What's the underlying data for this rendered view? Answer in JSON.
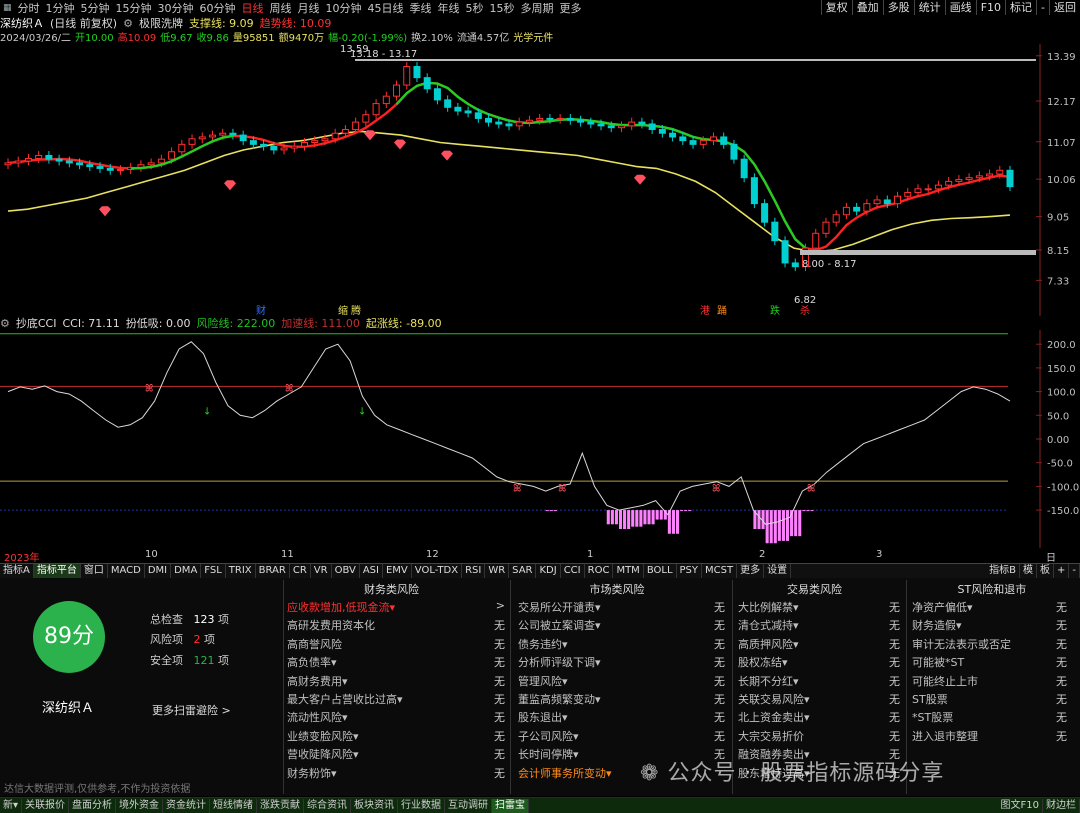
{
  "period_bar": [
    "分时",
    "1分钟",
    "5分钟",
    "15分钟",
    "30分钟",
    "60分钟",
    "日线",
    "周线",
    "月线",
    "10分钟",
    "45日线",
    "季线",
    "年线",
    "5秒",
    "15秒",
    "多周期",
    "更多"
  ],
  "period_active": "日线",
  "right_buttons": [
    "复权",
    "叠加",
    "多股",
    "统计",
    "画线",
    "F10",
    "标记",
    "-",
    "返回"
  ],
  "main_info": {
    "stock": "深纺织Ａ",
    "adj": "(日线 前复权)",
    "indicator": "极限洗牌",
    "support": "支撑线: 9.09",
    "trend": "趋势线: 10.09"
  },
  "quote": {
    "date": "2024/03/26/二",
    "open": "开10.00",
    "high": "高10.09",
    "low": "低9.67",
    "close": "收9.86",
    "volume": "量95851",
    "amount": "额9470万",
    "change": "幅-0.20(-1.99%)",
    "turnover": "换2.10%",
    "float": "流通4.57亿",
    "concept": "光学元件"
  },
  "price_axis": [
    "13.39",
    "12.17",
    "11.07",
    "10.06",
    "9.05",
    "8.15",
    "7.33"
  ],
  "annotations": {
    "high_label": "13.59",
    "high_range": "13.18 - 13.17",
    "low_range": "8.00 - 8.17",
    "low_label": "6.82"
  },
  "event_tags": [
    "财",
    "缩",
    "腾",
    "港",
    "踊",
    "跌",
    "杀"
  ],
  "cci_info": {
    "name": "抄底CCI",
    "cci": "CCI: 71.11",
    "low": "扮低吸: 0.00",
    "risk": "风险线: 222.00",
    "accel": "加速线: 111.00",
    "rise": "起涨线: -89.00"
  },
  "cci_axis": [
    "200.0",
    "150.0",
    "100.0",
    "50.0",
    "0.00",
    "-50.0",
    "-100.0",
    "-150.0"
  ],
  "date_axis": [
    "2023年",
    "10",
    "11",
    "12",
    "1",
    "2",
    "3",
    "日线"
  ],
  "tabs": [
    "指标A",
    "指标平台",
    "窗口",
    "MACD",
    "DMI",
    "DMA",
    "FSL",
    "TRIX",
    "BRAR",
    "CR",
    "VR",
    "OBV",
    "ASI",
    "EMV",
    "VOL-TDX",
    "RSI",
    "WR",
    "SAR",
    "KDJ",
    "CCI",
    "ROC",
    "MTM",
    "BOLL",
    "PSY",
    "MCST",
    "更多",
    "设置"
  ],
  "tabs_right": [
    "指标B",
    "模",
    "板",
    "+",
    "-"
  ],
  "score": {
    "value": "89分",
    "name": "深纺织Ａ",
    "total_label": "总检查",
    "total": "123",
    "unit": "项",
    "risk_label": "风险项",
    "risk": "2",
    "safe_label": "安全项",
    "safe": "121",
    "more": "更多扫雷避险 >",
    "disclaimer": "以上信息仅供参考,不作为投资依据",
    "disclaimer_display": "达信大数据评测,仅供参考,不作为投资依据"
  },
  "risk_columns": [
    {
      "title": "财务类风险",
      "items": [
        {
          "label": "应收款增加,低现金流▾",
          "value": ">",
          "hl": "red"
        },
        {
          "label": "高研发费用资本化",
          "value": "无"
        },
        {
          "label": "高商誉风险",
          "value": "无"
        },
        {
          "label": "高负债率▾",
          "value": "无"
        },
        {
          "label": "高财务费用▾",
          "value": "无"
        },
        {
          "label": "最大客户占营收比过高▾",
          "value": "无"
        },
        {
          "label": "流动性风险▾",
          "value": "无"
        },
        {
          "label": "业绩变脸风险▾",
          "value": "无"
        },
        {
          "label": "营收陡降风险▾",
          "value": "无"
        },
        {
          "label": "财务粉饰▾",
          "value": "无"
        }
      ]
    },
    {
      "title": "市场类风险",
      "items": [
        {
          "label": "交易所公开谴责▾",
          "value": "无"
        },
        {
          "label": "公司被立案调查▾",
          "value": "无"
        },
        {
          "label": "债务违约▾",
          "value": "无"
        },
        {
          "label": "分析师评级下调▾",
          "value": "无"
        },
        {
          "label": "管理风险▾",
          "value": "无"
        },
        {
          "label": "董监高频繁变动▾",
          "value": "无"
        },
        {
          "label": "股东退出▾",
          "value": "无"
        },
        {
          "label": "子公司风险▾",
          "value": "无"
        },
        {
          "label": "长时间停牌▾",
          "value": "无"
        },
        {
          "label": "会计师事务所变动▾",
          "value": "",
          "hl": "orange"
        }
      ]
    },
    {
      "title": "交易类风险",
      "items": [
        {
          "label": "大比例解禁▾",
          "value": "无"
        },
        {
          "label": "清仓式减持▾",
          "value": "无"
        },
        {
          "label": "高质押风险▾",
          "value": "无"
        },
        {
          "label": "股权冻结▾",
          "value": "无"
        },
        {
          "label": "长期不分红▾",
          "value": "无"
        },
        {
          "label": "关联交易风险▾",
          "value": "无"
        },
        {
          "label": "北上资金卖出▾",
          "value": "无"
        },
        {
          "label": "大宗交易折价",
          "value": "无"
        },
        {
          "label": "融资融券卖出▾",
          "value": "无"
        },
        {
          "label": "股东增持过高▾",
          "value": "无"
        }
      ]
    },
    {
      "title": "ST风险和退市",
      "items": [
        {
          "label": "净资产偏低▾",
          "value": "无"
        },
        {
          "label": "财务造假▾",
          "value": "无"
        },
        {
          "label": "审计无法表示或否定",
          "value": "无"
        },
        {
          "label": "可能被*ST",
          "value": "无"
        },
        {
          "label": "可能终止上市",
          "value": "无"
        },
        {
          "label": "ST股票",
          "value": "无"
        },
        {
          "label": "*ST股票",
          "value": "无"
        },
        {
          "label": "进入退市整理",
          "value": "无"
        }
      ]
    }
  ],
  "bottom_bar": [
    "新▾",
    "关联报价",
    "盘面分析",
    "境外资金",
    "资金统计",
    "短线情绪",
    "涨跌贡献",
    "综合资讯",
    "板块资讯",
    "行业数据",
    "互动调研",
    "扫雷宝"
  ],
  "bottom_right": [
    "图文F10",
    "财边栏"
  ],
  "watermark": "公众号 · 股票指标源码分享",
  "colors": {
    "up": "#ff3030",
    "down": "#00d0d0",
    "ma_up": "#ff2020",
    "ma_green": "#20d020",
    "support": "#e8e060",
    "cci_line": "#d8d8d8",
    "cci_bar": "#ff80ff",
    "risk_line": "#20c020",
    "accel_line": "#c03030",
    "rise_line": "#b0a040",
    "score_bg": "#2bb24c"
  },
  "chart_data": {
    "type": "candlestick",
    "price_range": [
      6.8,
      13.6
    ],
    "closes": [
      10.5,
      10.55,
      10.62,
      10.7,
      10.6,
      10.55,
      10.5,
      10.45,
      10.4,
      10.35,
      10.3,
      10.32,
      10.38,
      10.45,
      10.5,
      10.6,
      10.8,
      11.0,
      11.15,
      11.2,
      11.25,
      11.3,
      11.25,
      11.1,
      11.0,
      10.95,
      10.85,
      10.9,
      10.95,
      11.05,
      11.1,
      11.15,
      11.3,
      11.4,
      11.6,
      11.8,
      12.1,
      12.3,
      12.6,
      13.1,
      12.8,
      12.5,
      12.2,
      12.0,
      11.9,
      11.85,
      11.7,
      11.6,
      11.55,
      11.5,
      11.6,
      11.65,
      11.7,
      11.68,
      11.7,
      11.65,
      11.6,
      11.55,
      11.5,
      11.45,
      11.5,
      11.6,
      11.55,
      11.4,
      11.3,
      11.2,
      11.1,
      11.0,
      11.1,
      11.2,
      11.0,
      10.6,
      10.1,
      9.4,
      8.9,
      8.4,
      7.8,
      7.7,
      8.2,
      8.6,
      8.9,
      9.1,
      9.3,
      9.2,
      9.4,
      9.5,
      9.4,
      9.6,
      9.7,
      9.8,
      9.8,
      9.9,
      10.0,
      10.05,
      10.1,
      10.15,
      10.2,
      10.3,
      9.86
    ],
    "support_line": [
      9.2,
      9.25,
      9.35,
      9.45,
      9.55,
      9.7,
      9.85,
      10.0,
      10.15,
      10.3,
      10.5,
      10.7,
      10.85,
      10.95,
      11.05,
      11.1,
      11.2,
      11.3,
      11.35,
      11.3,
      11.25,
      11.15,
      11.05,
      11.0,
      10.95,
      10.9,
      10.85,
      10.8,
      10.75,
      10.7,
      10.6,
      10.5,
      10.4,
      10.35,
      10.2,
      10.0,
      9.7,
      9.3,
      8.9,
      8.5,
      8.2,
      8.1,
      8.15,
      8.3,
      8.5,
      8.7,
      8.85,
      8.95,
      9.0,
      9.02,
      9.05,
      9.09
    ],
    "cci": [
      100,
      110,
      105,
      112,
      100,
      95,
      80,
      60,
      40,
      25,
      30,
      45,
      80,
      140,
      190,
      205,
      180,
      120,
      70,
      50,
      45,
      60,
      80,
      95,
      110,
      150,
      190,
      200,
      165,
      90,
      50,
      30,
      20,
      10,
      0,
      -10,
      -20,
      -30,
      -40,
      -60,
      -80,
      -90,
      -95,
      -100,
      -110,
      -100,
      -95,
      -30,
      -100,
      -140,
      -150,
      -145,
      -140,
      -130,
      -160,
      -110,
      -100,
      -95,
      -90,
      -100,
      -80,
      -150,
      -180,
      -175,
      -165,
      -110,
      -95,
      -70,
      -50,
      -30,
      -10,
      0,
      10,
      20,
      30,
      40,
      60,
      80,
      100,
      110,
      105,
      95,
      80
    ]
  }
}
